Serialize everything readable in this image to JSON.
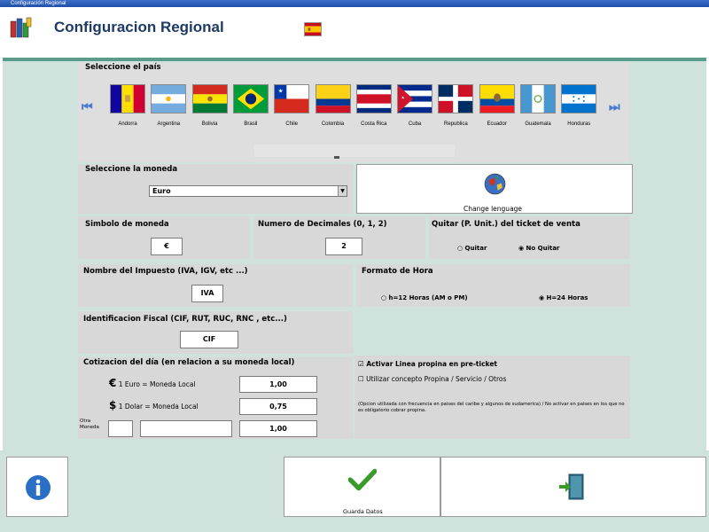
{
  "window": {
    "title": "Configuración Regional"
  },
  "header": {
    "title": "Configuracion Regional"
  },
  "country": {
    "label": "Seleccione el país",
    "items": [
      {
        "name": "Andorra"
      },
      {
        "name": "Argentina"
      },
      {
        "name": "Bolivia"
      },
      {
        "name": "Brasil"
      },
      {
        "name": "Chile"
      },
      {
        "name": "Colombia"
      },
      {
        "name": "Costa Rica"
      },
      {
        "name": "Cuba"
      },
      {
        "name": "Republica"
      },
      {
        "name": "Ecuador"
      },
      {
        "name": "Guatemala"
      },
      {
        "name": "Honduras"
      }
    ]
  },
  "currency": {
    "label": "Seleccione la moneda",
    "selected": "Euro",
    "change_language": "Change lenguage"
  },
  "symbol": {
    "label": "Simbolo de moneda",
    "value": "€"
  },
  "decimals": {
    "label": "Numero de Decimales (0, 1, 2)",
    "value": "2"
  },
  "ticket": {
    "label": "Quitar (P. Unit.) del ticket de venta",
    "opt1": "Quitar",
    "opt2": "No Quitar"
  },
  "tax": {
    "label": "Nombre del Impuesto (IVA, IGV, etc ...)",
    "value": "IVA"
  },
  "time_format": {
    "label": "Formato de Hora",
    "opt1": "h=12 Horas (AM o PM)",
    "opt2": "H=24 Horas"
  },
  "fiscal": {
    "label": "Identificacion Fiscal (CIF, RUT, RUC, RNC , etc...)",
    "value": "CIF"
  },
  "rates": {
    "label": "Cotizacion del día (en relacion a su moneda local)",
    "euro_symbol": "€",
    "euro_label": "1 Euro = Moneda Local",
    "euro_value": "1,00",
    "dollar_symbol": "$",
    "dollar_label": "1 Dolar = Moneda Local",
    "dollar_value": "0,75",
    "other_label1": "Otra",
    "other_label2": "Moneda",
    "other_value": "1,00"
  },
  "tip": {
    "activate": "Activar Linea propina en pre-ticket",
    "concept": "Utilizar concepto Propina / Servicio / Otros",
    "note": "(Opcion utilizada con frecuencia en paises del caribe y algunos de sudamerica) / No activar en paises en los que no es obligatorio cobrar propina."
  },
  "buttons": {
    "save": "Guarda Datos"
  },
  "colors": {
    "title": "#1f3a66",
    "accent": "#5a9b8e",
    "background": "#cfe3dc",
    "check": "#3a9a2a"
  }
}
